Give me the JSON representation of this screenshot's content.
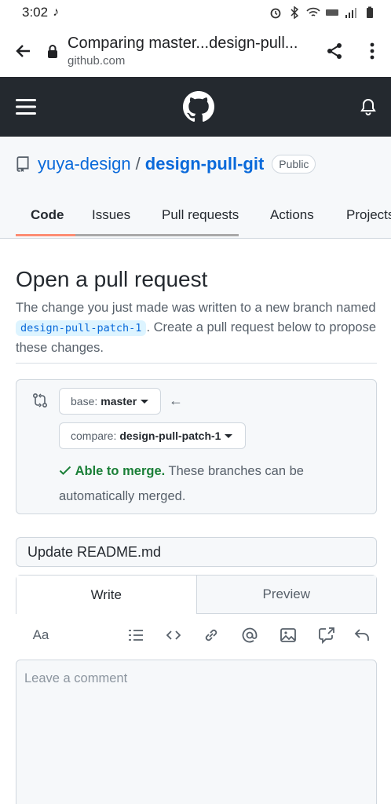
{
  "status_bar": {
    "time": "3:02",
    "note_icon": "music-note-icon"
  },
  "browser": {
    "page_title": "Comparing master...design-pull...",
    "host": "github.com"
  },
  "repo": {
    "owner": "yuya-design",
    "separator": "/",
    "name": "design-pull-git",
    "visibility": "Public"
  },
  "tabs": [
    {
      "label": "Code",
      "active": true
    },
    {
      "label": "Issues",
      "active": false
    },
    {
      "label": "Pull requests",
      "active": false
    },
    {
      "label": "Actions",
      "active": false
    },
    {
      "label": "Projects",
      "active": false
    }
  ],
  "main": {
    "heading": "Open a pull request",
    "desc_before": "The change you just made was written to a new branch named",
    "branch": "design-pull-patch-1",
    "desc_after": ". Create a pull request below to propose these changes.",
    "base_label": "base:",
    "base_value": "master",
    "compare_label": "compare:",
    "compare_value": "design-pull-patch-1",
    "merge_status": "Able to merge.",
    "merge_text": "These branches can be automatically merged.",
    "pr_title": "Update README.md",
    "tab_write": "Write",
    "tab_preview": "Preview",
    "font_tool": "Aa",
    "comment_placeholder": "Leave a comment"
  },
  "colors": {
    "header_bg": "#24292f",
    "link": "#0969da",
    "success": "#1a7f37",
    "active_tab_underline": "#fd8c73"
  }
}
